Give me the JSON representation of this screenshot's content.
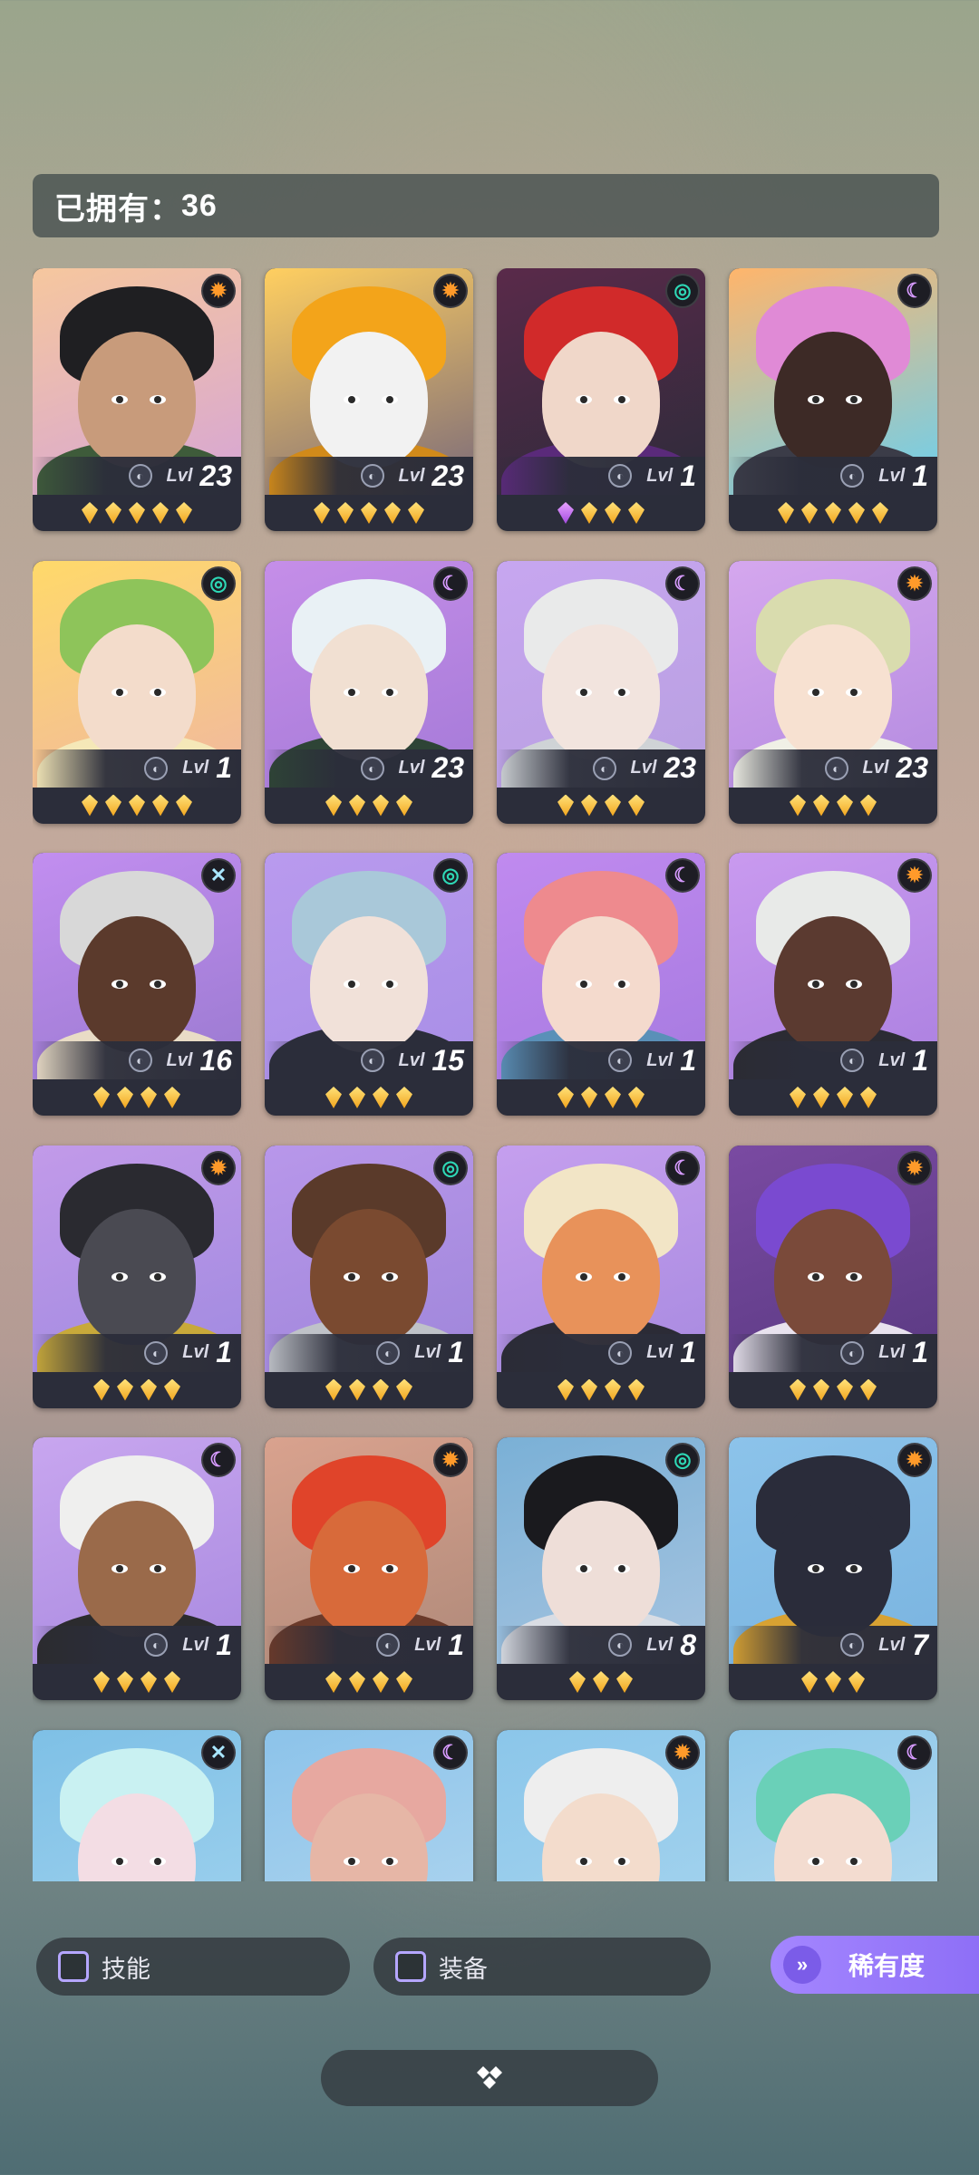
{
  "header": {
    "owned_label": "已拥有：",
    "owned_count": "36"
  },
  "heroes": [
    {
      "level": "23",
      "element": "sun",
      "stars": 5,
      "gem": "gold",
      "bg": [
        "#f6c79e",
        "#d6a5d6"
      ],
      "skin": "#c89b7b",
      "hair": "#1f1f22",
      "outfit": "#3e5b3a"
    },
    {
      "level": "23",
      "element": "sun",
      "stars": 5,
      "gem": "gold",
      "bg": [
        "#ffcf60",
        "#7a6a7a"
      ],
      "skin": "#f2f2f2",
      "hair": "#f3a41a",
      "outfit": "#d18a1a"
    },
    {
      "level": "1",
      "element": "swirl",
      "stars": 4,
      "gem": "mixed",
      "bg": [
        "#5a2a4a",
        "#2d2b3a"
      ],
      "skin": "#f0d7c9",
      "hair": "#d12a2a",
      "outfit": "#5a2a7a"
    },
    {
      "level": "1",
      "element": "moon",
      "stars": 5,
      "gem": "gold",
      "bg": [
        "#ffb56b",
        "#6ad0f0"
      ],
      "skin": "#3d2a26",
      "hair": "#e08ad6",
      "outfit": "#3b3c48"
    },
    {
      "level": "1",
      "element": "swirl",
      "stars": 5,
      "gem": "gold",
      "bg": [
        "#ffd96a",
        "#f0b8a0"
      ],
      "skin": "#f3dccb",
      "hair": "#8ec45a",
      "outfit": "#f5e8b8"
    },
    {
      "level": "23",
      "element": "moon",
      "stars": 4,
      "gem": "gold",
      "bg": [
        "#c58ee8",
        "#a57ad8"
      ],
      "skin": "#f1e0d2",
      "hair": "#e9f1f5",
      "outfit": "#2e4436"
    },
    {
      "level": "23",
      "element": "moon",
      "stars": 4,
      "gem": "gold",
      "bg": [
        "#c7a6f0",
        "#b8a0e0"
      ],
      "skin": "#f2e4de",
      "hair": "#e9eaea",
      "outfit": "#cfd3d6"
    },
    {
      "level": "23",
      "element": "sun",
      "stars": 4,
      "gem": "gold",
      "bg": [
        "#d5a7ee",
        "#b48be0"
      ],
      "skin": "#f7e1d1",
      "hair": "#d9dcae",
      "outfit": "#f0f0e6"
    },
    {
      "level": "16",
      "element": "x",
      "stars": 4,
      "gem": "gold",
      "bg": [
        "#c28ef0",
        "#9a7ad0"
      ],
      "skin": "#5b3a2c",
      "hair": "#d8d8d8",
      "outfit": "#e9dcc6"
    },
    {
      "level": "15",
      "element": "swirl",
      "stars": 4,
      "gem": "gold",
      "bg": [
        "#b99aee",
        "#a88ee6"
      ],
      "skin": "#f1e1d9",
      "hair": "#a9c8d9",
      "outfit": "#2b2d3a"
    },
    {
      "level": "1",
      "element": "moon",
      "stars": 4,
      "gem": "gold",
      "bg": [
        "#c08aef",
        "#a67ae0"
      ],
      "skin": "#f4dacd",
      "hair": "#ee8a8e",
      "outfit": "#5a90b8"
    },
    {
      "level": "1",
      "element": "sun",
      "stars": 4,
      "gem": "gold",
      "bg": [
        "#c99aef",
        "#ab80e0"
      ],
      "skin": "#5b3a30",
      "hair": "#e8eae8",
      "outfit": "#2b2b33"
    },
    {
      "level": "1",
      "element": "sun",
      "stars": 4,
      "gem": "gold",
      "bg": [
        "#c29ae9",
        "#a08ae0"
      ],
      "skin": "#4a4a52",
      "hair": "#2a2a30",
      "outfit": "#c8a93a"
    },
    {
      "level": "1",
      "element": "swirl",
      "stars": 4,
      "gem": "gold",
      "bg": [
        "#b897ea",
        "#9f86da"
      ],
      "skin": "#7a4a30",
      "hair": "#5a3a2a",
      "outfit": "#bfc2c8"
    },
    {
      "level": "1",
      "element": "moon",
      "stars": 4,
      "gem": "gold",
      "bg": [
        "#c59fee",
        "#a88ae0"
      ],
      "skin": "#e8925a",
      "hair": "#f2e5c6",
      "outfit": "#2b2b36"
    },
    {
      "level": "1",
      "element": "sun",
      "stars": 4,
      "gem": "gold",
      "bg": [
        "#7a4aa2",
        "#5a3a82"
      ],
      "skin": "#7a4a3a",
      "hair": "#7a4ad0",
      "outfit": "#e8e2ee"
    },
    {
      "level": "1",
      "element": "moon",
      "stars": 4,
      "gem": "gold",
      "bg": [
        "#c8a6ef",
        "#a98ae0"
      ],
      "skin": "#9a6a4a",
      "hair": "#efefee",
      "outfit": "#2b2b2e"
    },
    {
      "level": "1",
      "element": "sun",
      "stars": 4,
      "gem": "gold",
      "bg": [
        "#d9a28e",
        "#b08a7a"
      ],
      "skin": "#d86a3a",
      "hair": "#e0442a",
      "outfit": "#6a3a2a"
    },
    {
      "level": "8",
      "element": "swirl",
      "stars": 3,
      "gem": "gold",
      "bg": [
        "#7ab0d6",
        "#a6c4e0"
      ],
      "skin": "#eeded8",
      "hair": "#1a1a1e",
      "outfit": "#d9dde4"
    },
    {
      "level": "7",
      "element": "sun",
      "stars": 3,
      "gem": "gold",
      "bg": [
        "#8cc3ea",
        "#7ab4e0"
      ],
      "skin": "#2a2c3a",
      "hair": "#2a2c3a",
      "outfit": "#d8a232"
    },
    {
      "level": "",
      "element": "x",
      "stars": 0,
      "gem": "gold",
      "bg": [
        "#7ec0e6",
        "#a0d2ee"
      ],
      "skin": "#f3dde4",
      "hair": "#c9f1f2",
      "outfit": "#dcb4e6"
    },
    {
      "level": "",
      "element": "moon",
      "stars": 0,
      "gem": "gold",
      "bg": [
        "#8cc3ea",
        "#b0d6ef"
      ],
      "skin": "#e6b6a6",
      "hair": "#e7a8a0",
      "outfit": "#c98a8a"
    },
    {
      "level": "",
      "element": "sun",
      "stars": 0,
      "gem": "gold",
      "bg": [
        "#8bc6ea",
        "#a6d4ee"
      ],
      "skin": "#f3dccc",
      "hair": "#eeeeee",
      "outfit": "#9aa6b0"
    },
    {
      "level": "",
      "element": "moon",
      "stars": 0,
      "gem": "gold",
      "bg": [
        "#8fc8ea",
        "#b6dbef"
      ],
      "skin": "#f3dcd0",
      "hair": "#6ad0b8",
      "outfit": "#7a4a8a"
    }
  ],
  "level_prefix": "Lvl",
  "filters": {
    "skill_label": "技能",
    "equip_label": "装备"
  },
  "rarity": {
    "label": "稀有度",
    "icon": "double-chevron-down-icon"
  },
  "collapse": {
    "icon": "diamond-cluster-icon"
  },
  "colors": {
    "accent": "#9a7cfa",
    "sun": "#ff9a2a",
    "swirl": "#2ed8b6",
    "moon": "#d79bff",
    "x": "#a9e6ff"
  }
}
